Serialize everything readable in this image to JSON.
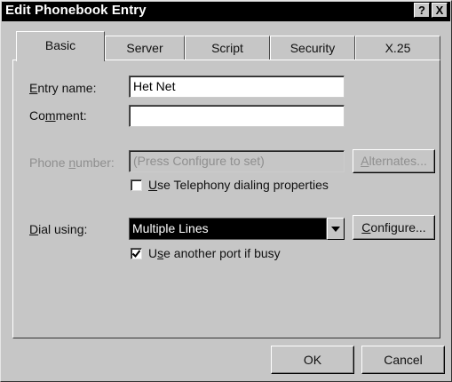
{
  "window": {
    "title": "Edit Phonebook Entry"
  },
  "titlebar_buttons": {
    "help": "?",
    "close": "X"
  },
  "tabs": [
    {
      "label": "Basic"
    },
    {
      "label": "Server"
    },
    {
      "label": "Script"
    },
    {
      "label": "Security"
    },
    {
      "label": "X.25"
    }
  ],
  "fields": {
    "entry_name": {
      "label_pre": "",
      "label_ul": "E",
      "label_post": "ntry name:",
      "value": "Het Net"
    },
    "comment": {
      "label_pre": "Co",
      "label_ul": "m",
      "label_post": "ment:",
      "value": ""
    },
    "phone_number": {
      "label_pre": "Phone ",
      "label_ul": "n",
      "label_post": "umber:",
      "value": "(Press Configure to set)"
    },
    "alternates_button": {
      "label_pre": "",
      "label_ul": "A",
      "label_post": "lternates..."
    },
    "telephony": {
      "label_pre": "",
      "label_ul": "U",
      "label_post": "se Telephony dialing properties",
      "checked": false
    },
    "dial_using": {
      "label_pre": "",
      "label_ul": "D",
      "label_post": "ial using:",
      "value": "Multiple Lines"
    },
    "configure_button": {
      "label_pre": "",
      "label_ul": "C",
      "label_post": "onfigure..."
    },
    "another_port": {
      "label_pre": "U",
      "label_ul": "s",
      "label_post": "e another port if busy",
      "checked": true
    }
  },
  "buttons": {
    "ok": "OK",
    "cancel": "Cancel"
  }
}
